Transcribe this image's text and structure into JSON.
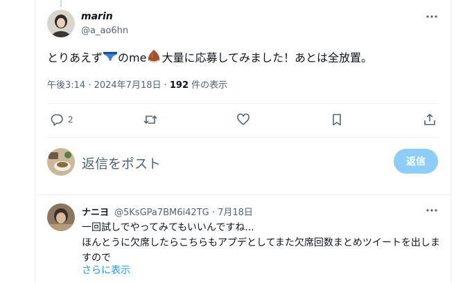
{
  "tweet": {
    "display_name": "marin",
    "handle": "@a_ao6hn",
    "text_part1": "とりあえず",
    "text_part2": "のme",
    "text_part3": "大量に応募してみました！あとは全放置。",
    "timestamp": "午後3:14 · 2024年7月18日 · ",
    "views_count": "192",
    "views_label": " 件の表示",
    "reply_count": "2"
  },
  "icons": {
    "more": "more-horizontal-icon",
    "reply": "reply-icon",
    "retweet": "retweet-icon",
    "like": "heart-icon",
    "bookmark": "bookmark-icon",
    "share": "share-icon",
    "emoji1": "briefs-emoji",
    "emoji2": "chestnut-emoji"
  },
  "composer": {
    "placeholder": "返信をポスト",
    "button_label": "返信"
  },
  "reply": {
    "display_name": "ナニヨ",
    "handle_date": "@5KsGPa7BM6i42TG · 7月18日",
    "line1": "一回試しでやってみてもいいんですね...",
    "line2": "ほんとうに欠席したらこちらもアプデとしてまた欠席回数まとめツイートを出しますので",
    "show_more": "さらに表示"
  },
  "colors": {
    "accent": "#1d9bf0",
    "button_disabled": "#8ecdf7",
    "secondary_text": "#536471",
    "border": "#eff3f4"
  }
}
